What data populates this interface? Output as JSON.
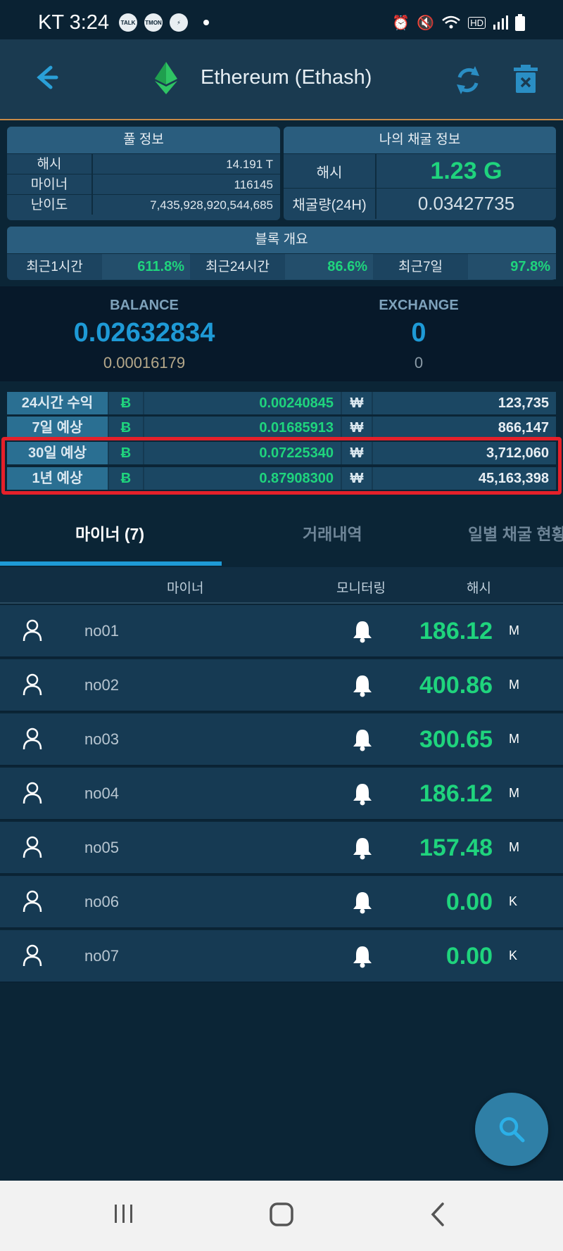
{
  "status_bar": {
    "time": "KT 3:24",
    "notifications": [
      "TALK",
      "TMON",
      "⚡"
    ]
  },
  "app_bar": {
    "title": "Ethereum (Ethash)"
  },
  "pool_info": {
    "header": "풀 정보",
    "rows": [
      {
        "label": "해시",
        "value": "14.191 T"
      },
      {
        "label": "마이너",
        "value": "116145"
      },
      {
        "label": "난이도",
        "value": "7,435,928,920,544,685"
      }
    ]
  },
  "my_info": {
    "header": "나의 채굴 정보",
    "hash_label": "해시",
    "hash_value": "1.23 G",
    "amount_label": "채굴량(24H)",
    "amount_value": "0.03427735"
  },
  "block_summary": {
    "header": "블록 개요",
    "items": [
      {
        "label": "최근1시간",
        "value": "611.8%"
      },
      {
        "label": "최근24시간",
        "value": "86.6%"
      },
      {
        "label": "최근7일",
        "value": "97.8%"
      }
    ]
  },
  "balance": {
    "label": "BALANCE",
    "value": "0.02632834",
    "sub": "0.00016179"
  },
  "exchange": {
    "label": "EXCHANGE",
    "value": "0",
    "sub": "0"
  },
  "earnings": [
    {
      "label": "24시간 수익",
      "coin_symbol": "Ƀ",
      "coin_value": "0.00240845",
      "krw_symbol": "₩",
      "krw_value": "123,735"
    },
    {
      "label": "7일 예상",
      "coin_symbol": "Ƀ",
      "coin_value": "0.01685913",
      "krw_symbol": "₩",
      "krw_value": "866,147"
    },
    {
      "label": "30일 예상",
      "coin_symbol": "Ƀ",
      "coin_value": "0.07225340",
      "krw_symbol": "₩",
      "krw_value": "3,712,060"
    },
    {
      "label": "1년 예상",
      "coin_symbol": "Ƀ",
      "coin_value": "0.87908300",
      "krw_symbol": "₩",
      "krw_value": "45,163,398"
    }
  ],
  "tabs": [
    {
      "label": "마이너 (7)"
    },
    {
      "label": "거래내역"
    },
    {
      "label": "일별 채굴 현황"
    }
  ],
  "miner_table": {
    "col_miner": "마이너",
    "col_monitor": "모니터링",
    "col_hash": "해시",
    "rows": [
      {
        "name": "no01",
        "hash": "186.12",
        "unit": "M"
      },
      {
        "name": "no02",
        "hash": "400.86",
        "unit": "M"
      },
      {
        "name": "no03",
        "hash": "300.65",
        "unit": "M"
      },
      {
        "name": "no04",
        "hash": "186.12",
        "unit": "M"
      },
      {
        "name": "no05",
        "hash": "157.48",
        "unit": "M"
      },
      {
        "name": "no06",
        "hash": "0.00",
        "unit": "K"
      },
      {
        "name": "no07",
        "hash": "0.00",
        "unit": "K"
      }
    ]
  },
  "colors": {
    "accent": "#1e9ad6",
    "positive": "#1fd47d",
    "highlight": "#e5202a"
  }
}
